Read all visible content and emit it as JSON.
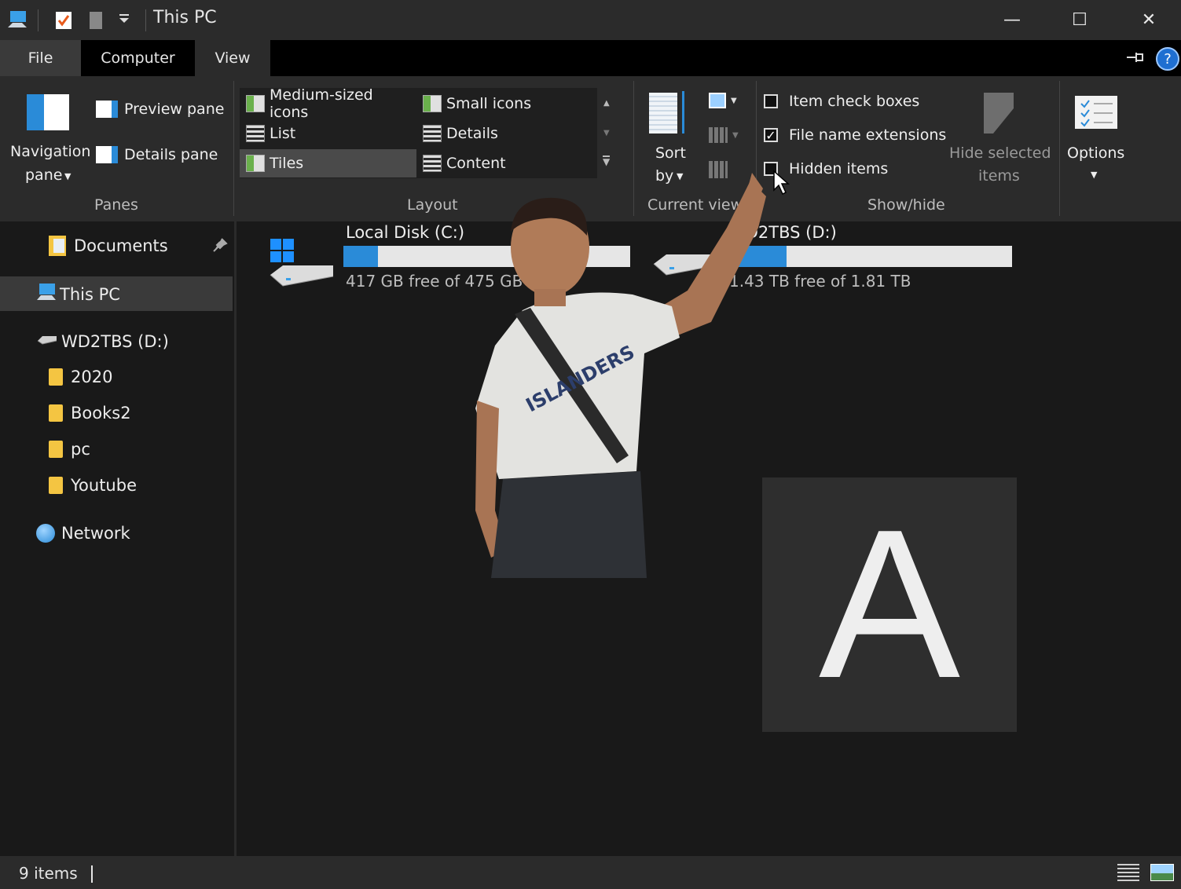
{
  "window": {
    "title": "This PC",
    "controls": {
      "minimize": "—",
      "maximize": "☐",
      "close": "✕"
    }
  },
  "tabs": {
    "file": "File",
    "computer": "Computer",
    "view": "View"
  },
  "ribbon": {
    "panes": {
      "navigation_pane_line1": "Navigation",
      "navigation_pane_line2": "pane",
      "preview_pane": "Preview pane",
      "details_pane": "Details pane",
      "group_label": "Panes"
    },
    "layout": {
      "items": [
        "Medium-sized icons",
        "Small icons",
        "List",
        "Details",
        "Tiles",
        "Content"
      ],
      "selected": "Tiles",
      "group_label": "Layout"
    },
    "current_view": {
      "sort_by_line1": "Sort",
      "sort_by_line2": "by",
      "group_label": "Current view"
    },
    "show_hide": {
      "item_check_boxes": "Item check boxes",
      "file_name_extensions": "File name extensions",
      "hidden_items": "Hidden items",
      "hide_selected_line1": "Hide selected",
      "hide_selected_line2": "items",
      "group_label": "Show/hide",
      "checked": {
        "item_check_boxes": false,
        "file_name_extensions": true,
        "hidden_items": false
      }
    },
    "options": {
      "label": "Options"
    }
  },
  "nav": {
    "documents": "Documents",
    "this_pc": "This PC",
    "drive_d": "WD2TBS (D:)",
    "folders": [
      "2020",
      "Books2",
      "pc",
      "Youtube"
    ],
    "network": "Network"
  },
  "drives": [
    {
      "name": "Local Disk (C:)",
      "info": "417 GB free of 475 GB",
      "used_fraction": 0.12
    },
    {
      "name": "WD2TBS (D:)",
      "info": "1.43 TB free of 1.81 TB",
      "used_fraction": 0.21
    }
  ],
  "overlay": {
    "letter": "A"
  },
  "status": {
    "items": "9 items"
  },
  "colors": {
    "accent": "#2a8bd8",
    "help": "#1f6fd1",
    "folder": "#f4c542"
  }
}
